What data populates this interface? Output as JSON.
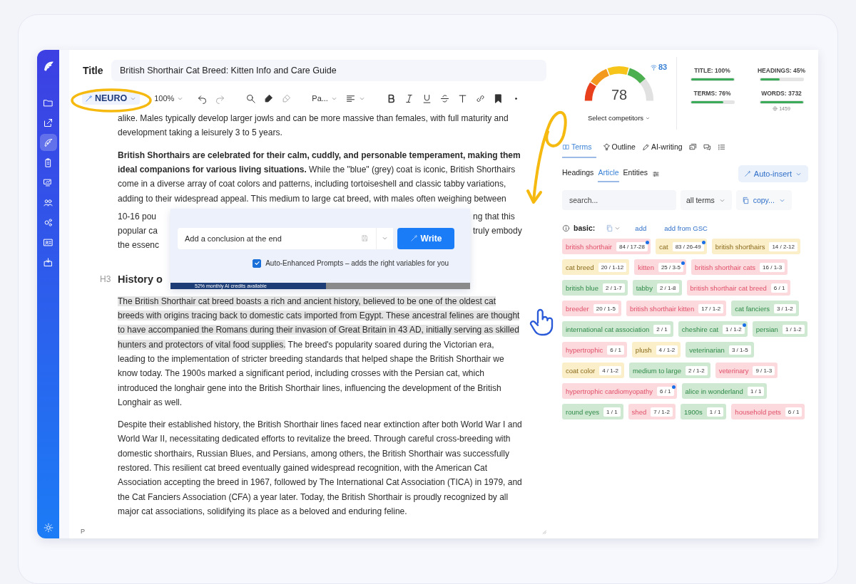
{
  "sidebar": {
    "items": [
      {
        "selected": false
      },
      {
        "selected": false
      },
      {
        "selected": true
      },
      {
        "selected": false
      },
      {
        "selected": false
      },
      {
        "selected": false
      },
      {
        "selected": false
      },
      {
        "selected": false
      },
      {
        "selected": false
      }
    ]
  },
  "editor": {
    "title_label": "Title",
    "title": "British Shorthair Cat Breed: Kitten Info and Care Guide",
    "toolbar": {
      "mode": "NEURO",
      "zoom": "100%",
      "block": "Pa...",
      "redo_disabled": true
    },
    "intro": "alike. Males typically develop larger jowls and can be more massive than females, with full maturity and development taking a leisurely 3 to 5 years.",
    "paragraph_2": "**British Shorthairs are celebrated for their calm, cuddly, and personable temperament, making them ideal companions for various living situations.** While the \"blue\" (grey) coat is iconic, British Shorthairs come in a diverse array of coat colors and patterns, including tortoiseshell and classic tabby variations, adding to their widespread appeal. This medium to large cat breed, with males often weighing between",
    "covered_lines": [
      {
        "left": "10-16 pou",
        "right": "ng that this"
      },
      {
        "left": "popular ca",
        "right": "truly embody"
      },
      {
        "left": "the essenc"
      }
    ],
    "heading": {
      "marker": "H3",
      "text": "History o"
    },
    "popup": {
      "prompt": "Add a conclusion at the end",
      "write": "Write",
      "auto_label": "Auto-Enhanced Prompts – adds the right variables for you",
      "auto_checked": true,
      "credits": "52% monthly AI credits available",
      "level": 0.52
    },
    "paragraph_3": {
      "highlight": "The British Shorthair cat breed boasts a rich and ancient history, believed to be one of the oldest cat breeds with origins tracing back to domestic cats imported from Egypt. These ancestral felines are thought to have accompanied the Romans during their invasion of Great Britain in 43 AD, initially serving as skilled hunters and protectors of vital food supplies.",
      "text": " The breed's popularity soared during the Victorian era, leading to the implementation of stricter breeding standards that helped shape the British Shorthair we know today. The 1900s marked a significant period, including crosses with the Persian cat, which introduced the longhair gene into the British Shorthair lines, influencing the development of the British Longhair as well."
    },
    "paragraph_4": "Despite their established history, the British Shorthair lines faced near extinction after both World War I and World War II, necessitating dedicated efforts to revitalize the breed. Through careful cross-breeding with domestic shorthairs, Russian Blues, and Persians, among others, the British Shorthair was successfully restored. This resilient cat breed eventually gained widespread recognition, with the American Cat Association accepting the breed in 1967, followed by The International Cat Association (TICA) in 1979, and the Cat Fanciers Association (CFA) a year later. Today, the British Shorthair is proudly recognized by all major cat associations, solidifying its place as a beloved and enduring feline.",
    "status": "P"
  },
  "panel": {
    "score": {
      "value": "78",
      "level": 0.78,
      "target": "83",
      "competitors": "Select competitors"
    },
    "metrics": [
      {
        "label": "TITLE: 100%",
        "level": 1
      },
      {
        "label": "HEADINGS: 45%",
        "level": 0.45
      },
      {
        "label": "TERMS: 76%",
        "level": 0.76
      },
      {
        "label": "WORDS: 3732",
        "level": 1,
        "note": "1459"
      }
    ],
    "tabs": [
      {
        "label": "Terms",
        "selected": true
      },
      {
        "label": "Outline",
        "selected": false
      },
      {
        "label": "AI-writing",
        "selected": false
      }
    ],
    "icon_tabs": [
      {
        "selected": false
      },
      {
        "selected": false
      },
      {
        "selected": false
      }
    ],
    "subtabs": [
      {
        "label": "Headings",
        "selected": false
      },
      {
        "label": "Article",
        "selected": true
      },
      {
        "label": "Entities",
        "selected": false
      }
    ],
    "auto_insert": "Auto-insert",
    "search": {
      "placeholder": "search..."
    },
    "filter": "all terms",
    "copy": "copy...",
    "basic": {
      "label": "basic:",
      "add": "add",
      "add_gsc": "add from GSC"
    },
    "terms": [
      {
        "term": "british shorthair",
        "count": "84 / 17-28",
        "color": "#fcd9dc",
        "flagged": true
      },
      {
        "term": "cat",
        "count": "83 / 26-49",
        "color": "#fbefc9",
        "flagged": true
      },
      {
        "term": "british shorthairs",
        "count": "14 / 2-12",
        "color": "#fbefc9",
        "flagged": false
      },
      {
        "term": "cat breed",
        "count": "20 / 1-12",
        "color": "#fbefc9",
        "flagged": false
      },
      {
        "term": "kitten",
        "count": "25 / 3-5",
        "color": "#fcd9dc",
        "flagged": true
      },
      {
        "term": "british shorthair cats",
        "count": "16 / 1-3",
        "color": "#fcd9dc",
        "flagged": false
      },
      {
        "term": "british blue",
        "count": "2 / 1-7",
        "color": "#cfe8d2",
        "flagged": false
      },
      {
        "term": "tabby",
        "count": "2 / 1-8",
        "color": "#cfe8d2",
        "flagged": false
      },
      {
        "term": "british shorthair cat breed",
        "count": "6 / 1",
        "color": "#fcd9dc",
        "flagged": false
      },
      {
        "term": "breeder",
        "count": "20 / 1-5",
        "color": "#fcd9dc",
        "flagged": false
      },
      {
        "term": "british shorthair kitten",
        "count": "17 / 1-2",
        "color": "#fcd9dc",
        "flagged": false
      },
      {
        "term": "cat fanciers",
        "count": "3 / 1-2",
        "color": "#cfe8d2",
        "flagged": false
      },
      {
        "term": "international cat association",
        "count": "2 / 1",
        "color": "#cfe8d2",
        "flagged": false
      },
      {
        "term": "cheshire cat",
        "count": "1 / 1-2",
        "color": "#cfe8d2",
        "flagged": true
      },
      {
        "term": "persian",
        "count": "1 / 1-2",
        "color": "#cfe8d2",
        "flagged": false
      },
      {
        "term": "hypertrophic",
        "count": "6 / 1",
        "color": "#fcd9dc",
        "flagged": false
      },
      {
        "term": "plush",
        "count": "4 / 1-2",
        "color": "#fbefc9",
        "flagged": false
      },
      {
        "term": "veterinarian",
        "count": "3 / 1-5",
        "color": "#cfe8d2",
        "flagged": false
      },
      {
        "term": "coat color",
        "count": "4 / 1-2",
        "color": "#fbefc9",
        "flagged": false
      },
      {
        "term": "medium to large",
        "count": "2 / 1-2",
        "color": "#cfe8d2",
        "flagged": false
      },
      {
        "term": "veterinary",
        "count": "9 / 1-3",
        "color": "#fcd9dc",
        "flagged": false
      },
      {
        "term": "hypertrophic cardiomyopathy",
        "count": "6 / 1",
        "color": "#fcd9dc",
        "flagged": true
      },
      {
        "term": "alice in wonderland",
        "count": "1 / 1",
        "color": "#cfe8d2",
        "flagged": false
      },
      {
        "term": "round eyes",
        "count": "1 / 1",
        "color": "#cfe8d2",
        "flagged": false
      },
      {
        "term": "shed",
        "count": "7 / 1-2",
        "color": "#fcd9dc",
        "flagged": false
      },
      {
        "term": "1900s",
        "count": "1 / 1",
        "color": "#cfe8d2",
        "flagged": false
      },
      {
        "term": "household pets",
        "count": "6 / 1",
        "color": "#fcd9dc",
        "flagged": false
      }
    ]
  }
}
